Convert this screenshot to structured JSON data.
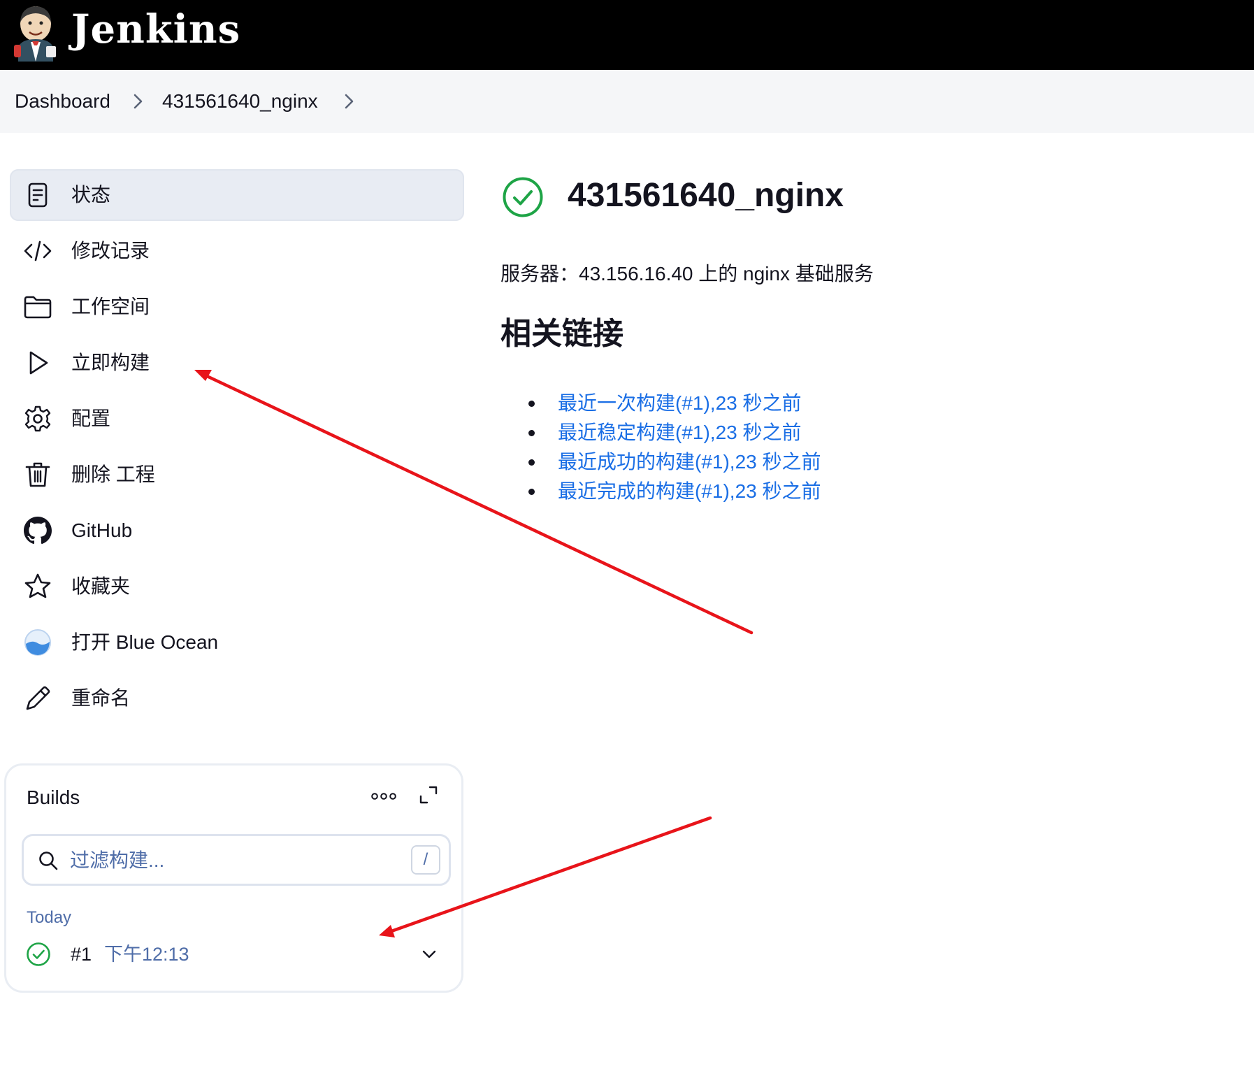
{
  "app": {
    "brand": "Jenkins"
  },
  "breadcrumb": {
    "items": [
      "Dashboard",
      "431561640_nginx"
    ]
  },
  "sidebar": {
    "items": [
      {
        "label": "状态",
        "icon": "document-icon"
      },
      {
        "label": "修改记录",
        "icon": "code-icon"
      },
      {
        "label": "工作空间",
        "icon": "folder-icon"
      },
      {
        "label": "立即构建",
        "icon": "play-icon"
      },
      {
        "label": "配置",
        "icon": "gear-icon"
      },
      {
        "label": "删除 工程",
        "icon": "trash-icon"
      },
      {
        "label": "GitHub",
        "icon": "github-icon"
      },
      {
        "label": "收藏夹",
        "icon": "star-icon"
      },
      {
        "label": "打开 Blue Ocean",
        "icon": "blue-ocean-icon"
      },
      {
        "label": "重命名",
        "icon": "pencil-icon"
      }
    ]
  },
  "builds": {
    "title": "Builds",
    "filter_placeholder": "过滤构建...",
    "filter_shortcut": "/",
    "group": "Today",
    "items": [
      {
        "number": "#1",
        "time": "下午12:13",
        "status": "success"
      }
    ]
  },
  "main": {
    "title": "431561640_nginx",
    "description": "服务器：43.156.16.40 上的 nginx 基础服务",
    "related_heading": "相关链接",
    "links": [
      "最近一次构建(#1),23 秒之前",
      "最近稳定构建(#1),23 秒之前",
      "最近成功的构建(#1),23 秒之前",
      "最近完成的构建(#1),23 秒之前"
    ]
  },
  "colors": {
    "success": "#1ea446",
    "link": "#1a6ee5",
    "annotation": "#e8141a",
    "header_bg": "#000000"
  }
}
